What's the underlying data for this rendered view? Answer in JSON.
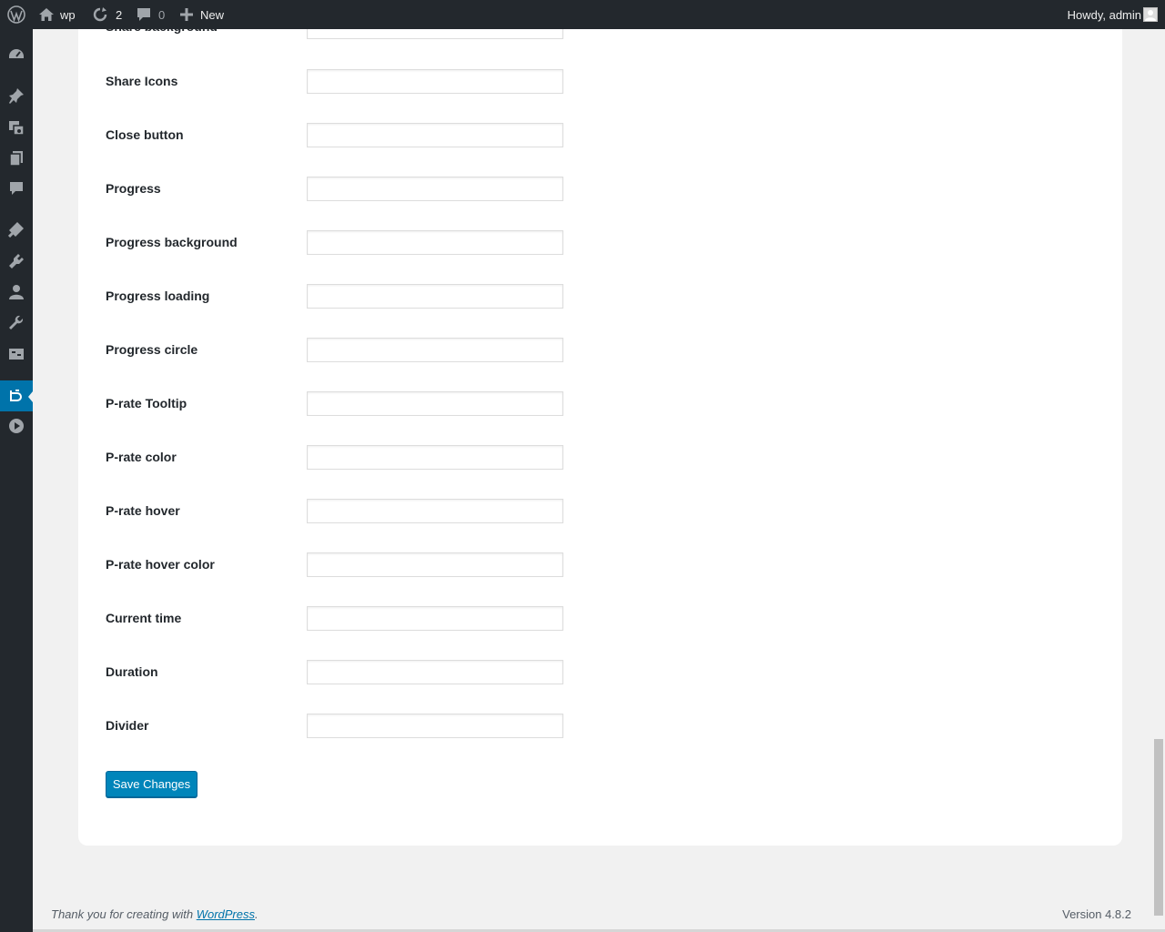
{
  "adminbar": {
    "site_name": "wp",
    "updates_count": "2",
    "comments_count": "0",
    "new_label": "New",
    "account_label": "Howdy, admin"
  },
  "sidebar": {
    "icons": [
      "dashboard-icon",
      "posts-icon",
      "media-icon",
      "pages-icon",
      "comments-icon",
      "appearance-icon",
      "plugins-icon",
      "users-icon",
      "tools-icon",
      "settings-icon",
      "player-plugin-icon",
      "video-icon"
    ],
    "current": "player-plugin-icon",
    "accent_color": "#0073aa"
  },
  "form": {
    "fields": [
      {
        "label": "Share background",
        "value": ""
      },
      {
        "label": "Share Icons",
        "value": ""
      },
      {
        "label": "Close button",
        "value": ""
      },
      {
        "label": "Progress",
        "value": ""
      },
      {
        "label": "Progress background",
        "value": ""
      },
      {
        "label": "Progress loading",
        "value": ""
      },
      {
        "label": "Progress circle",
        "value": ""
      },
      {
        "label": "P-rate Tooltip",
        "value": ""
      },
      {
        "label": "P-rate color",
        "value": ""
      },
      {
        "label": "P-rate hover",
        "value": ""
      },
      {
        "label": "P-rate hover color",
        "value": ""
      },
      {
        "label": "Current time",
        "value": ""
      },
      {
        "label": "Duration",
        "value": ""
      },
      {
        "label": "Divider",
        "value": ""
      }
    ],
    "save_label": "Save Changes"
  },
  "footer": {
    "thanks_prefix": "Thank you for creating with ",
    "thanks_link": "WordPress",
    "thanks_suffix": ".",
    "version": "Version 4.8.2"
  }
}
